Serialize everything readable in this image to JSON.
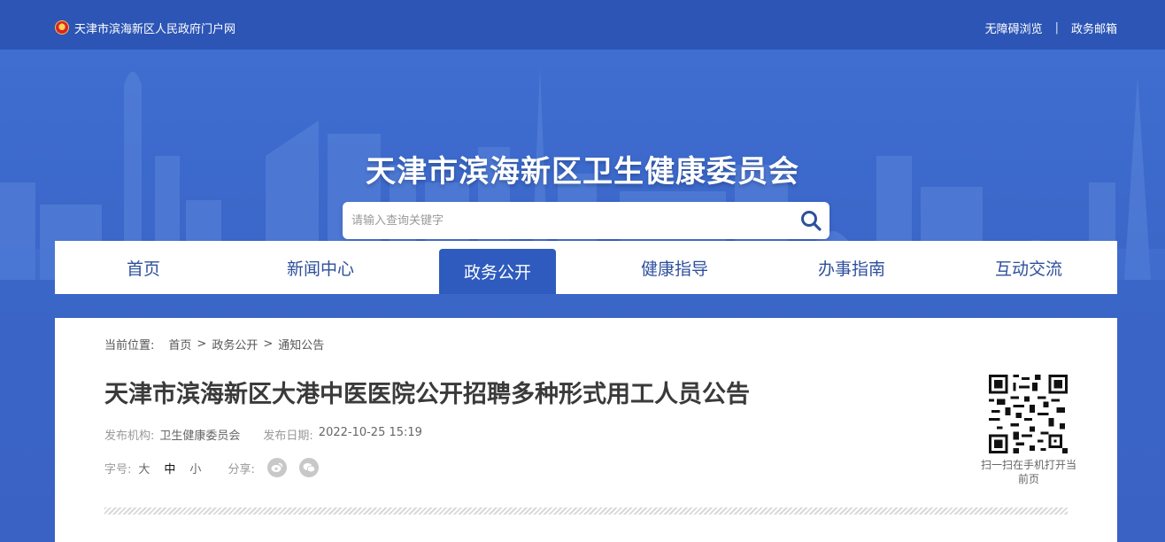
{
  "topbar": {
    "site_name": "天津市滨海新区人民政府门户网",
    "links": [
      "无障碍浏览",
      "政务邮箱"
    ],
    "separator": "|"
  },
  "header": {
    "title": "天津市滨海新区卫生健康委员会",
    "search": {
      "placeholder": "请输入查询关键字",
      "icon": "search-icon"
    }
  },
  "nav": {
    "items": [
      "首页",
      "新闻中心",
      "政务公开",
      "健康指导",
      "办事指南",
      "互动交流"
    ],
    "active": "政务公开"
  },
  "breadcrumb": {
    "label": "当前位置:",
    "items": [
      "首页",
      "政务公开",
      "通知公告"
    ],
    "separator": ">"
  },
  "article": {
    "title": "天津市滨海新区大港中医医院公开招聘多种形式用工人员公告",
    "publisher_label": "发布机构:",
    "publisher": "卫生健康委员会",
    "date_label": "发布日期:",
    "date": "2022-10-25 15:19",
    "font_label": "字号:",
    "font_sizes": [
      "大",
      "中",
      "小"
    ],
    "share_label": "分享:",
    "share_icons": [
      "weibo-icon",
      "wechat-icon"
    ]
  },
  "qr": {
    "caption": "扫一扫在手机打开当前页"
  },
  "colors": {
    "topbar": "#2c55b5",
    "banner": "#3a66c8",
    "nav_active": "#2e5bbd",
    "nav_text": "#2e4f9c"
  }
}
